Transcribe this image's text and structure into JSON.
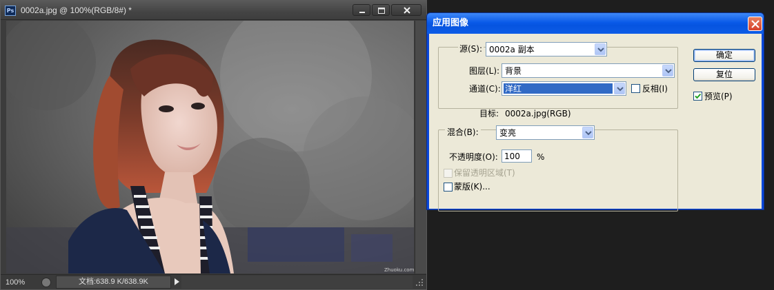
{
  "document_window": {
    "title": "0002a.jpg @ 100%(RGB/8#) *",
    "app_badge": "Ps",
    "status": {
      "zoom": "100%",
      "doc_info": "文档:638.9 K/638.9K"
    },
    "watermark": "Zhuoku.com"
  },
  "dialog": {
    "title": "应用图像",
    "source": {
      "label": "源(S):",
      "value": "0002a 副本"
    },
    "layer": {
      "label": "图层(L):",
      "value": "背景"
    },
    "channel": {
      "label": "通道(C):",
      "value": "洋红"
    },
    "invert": {
      "label": "反相(I)",
      "checked": false
    },
    "target": {
      "label": "目标:",
      "value": "0002a.jpg(RGB)"
    },
    "blending": {
      "label": "混合(B):",
      "value": "变亮"
    },
    "opacity": {
      "label": "不透明度(O):",
      "value": "100",
      "unit": "%"
    },
    "preserve_transparency": {
      "label": "保留透明区域(T)",
      "checked": false,
      "enabled": false
    },
    "mask": {
      "label": "蒙版(K)...",
      "checked": false
    },
    "buttons": {
      "ok": "确定",
      "reset": "复位"
    },
    "preview": {
      "label": "预览(P)",
      "checked": true
    }
  }
}
